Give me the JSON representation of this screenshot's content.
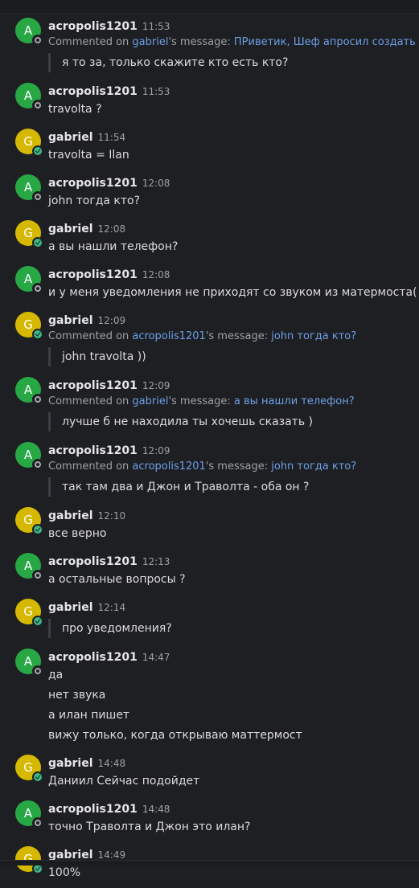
{
  "posts": [
    {
      "author": "acropolis1201",
      "initial": "A",
      "avatar": "a",
      "status": "offline",
      "time": "11:53",
      "comment": {
        "prefix": "Commented on ",
        "user": "gabriel",
        "mid": "'s message: ",
        "quote": "ПРиветик, Шеф апросил создать их"
      },
      "reply": "я то за, только скажите кто есть кто?"
    },
    {
      "author": "acropolis1201",
      "initial": "A",
      "avatar": "a",
      "status": "offline",
      "time": "11:53",
      "lines": [
        "travolta ?"
      ]
    },
    {
      "author": "gabriel",
      "initial": "G",
      "avatar": "g",
      "status": "online",
      "time": "11:54",
      "lines": [
        "travolta = Ilan"
      ]
    },
    {
      "author": "acropolis1201",
      "initial": "A",
      "avatar": "a",
      "status": "offline",
      "time": "12:08",
      "lines": [
        "john тогда кто?"
      ]
    },
    {
      "author": "gabriel",
      "initial": "G",
      "avatar": "g",
      "status": "online",
      "time": "12:08",
      "lines": [
        "а вы нашли телефон?"
      ]
    },
    {
      "author": "acropolis1201",
      "initial": "A",
      "avatar": "a",
      "status": "offline",
      "time": "12:08",
      "lines": [
        "и у меня уведомления не приходят со звуком из матермоста("
      ]
    },
    {
      "author": "gabriel",
      "initial": "G",
      "avatar": "g",
      "status": "online",
      "time": "12:09",
      "comment": {
        "prefix": "Commented on ",
        "user": "acropolis1201",
        "mid": "'s message: ",
        "quote": "john тогда кто?"
      },
      "reply": "john travolta ))"
    },
    {
      "author": "acropolis1201",
      "initial": "A",
      "avatar": "a",
      "status": "offline",
      "time": "12:09",
      "comment": {
        "prefix": "Commented on ",
        "user": "gabriel",
        "mid": "'s message: ",
        "quote": "а вы нашли телефон?"
      },
      "reply": "лучше б не находила ты хочешь сказать )"
    },
    {
      "author": "acropolis1201",
      "initial": "A",
      "avatar": "a",
      "status": "offline",
      "time": "12:09",
      "comment": {
        "prefix": "Commented on ",
        "user": "acropolis1201",
        "mid": "'s message: ",
        "quote": "john тогда кто?"
      },
      "reply": "так там два и Джон и Траволта - оба он ?"
    },
    {
      "author": "gabriel",
      "initial": "G",
      "avatar": "g",
      "status": "online",
      "time": "12:10",
      "lines": [
        "все верно"
      ]
    },
    {
      "author": "acropolis1201",
      "initial": "A",
      "avatar": "a",
      "status": "offline",
      "time": "12:13",
      "lines": [
        "а остальные вопросы ?"
      ]
    },
    {
      "author": "gabriel",
      "initial": "G",
      "avatar": "g",
      "status": "online",
      "time": "12:14",
      "reply": "про уведомления?"
    },
    {
      "author": "acropolis1201",
      "initial": "A",
      "avatar": "a",
      "status": "offline",
      "time": "14:47",
      "lines": [
        "да",
        "нет звука",
        "а илан пишет",
        "вижу только, когда открываю маттермост"
      ]
    },
    {
      "author": "gabriel",
      "initial": "G",
      "avatar": "g",
      "status": "online",
      "time": "14:48",
      "lines": [
        "Даниил Сейчас подойдет"
      ]
    },
    {
      "author": "acropolis1201",
      "initial": "A",
      "avatar": "a",
      "status": "offline",
      "time": "14:48",
      "lines": [
        "точно Траволта и Джон это илан?"
      ]
    },
    {
      "author": "gabriel",
      "initial": "G",
      "avatar": "g",
      "status": "online",
      "time": "14:49",
      "lines": [
        "100%"
      ]
    }
  ]
}
